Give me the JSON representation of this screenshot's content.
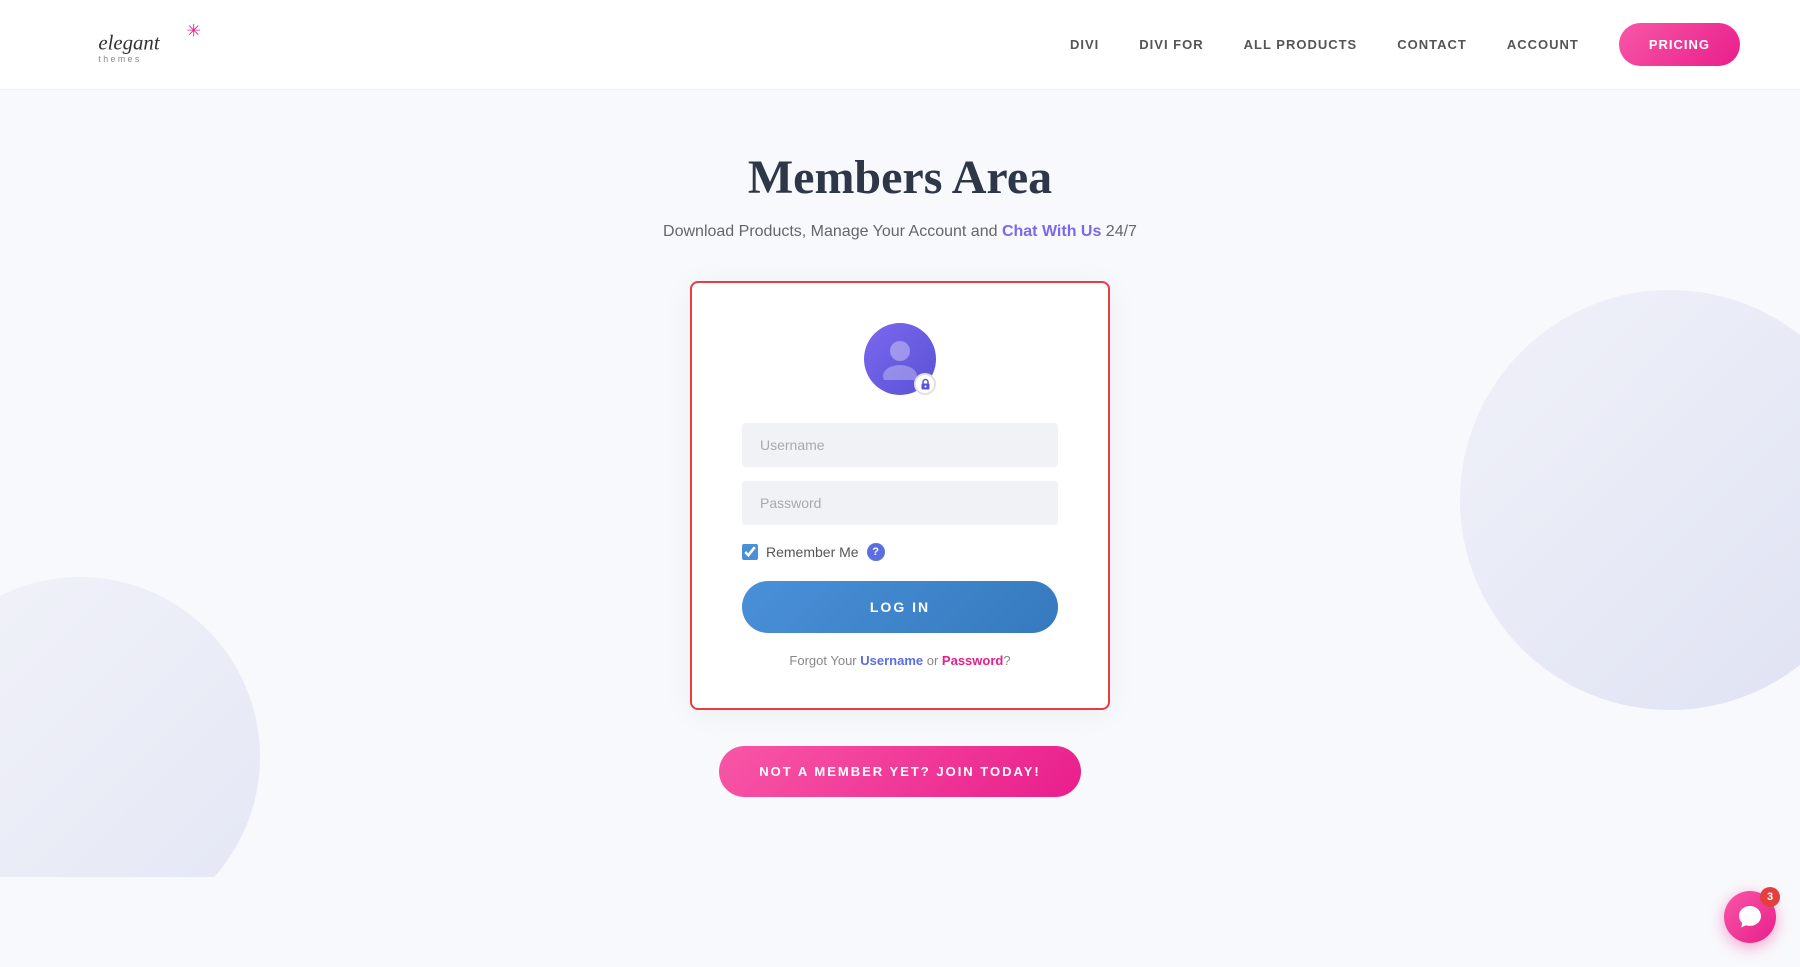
{
  "header": {
    "logo_alt": "Elegant Themes",
    "nav_items": [
      {
        "label": "DIVI",
        "key": "divi"
      },
      {
        "label": "DIVI FOR",
        "key": "divi-for"
      },
      {
        "label": "ALL PRODUCTS",
        "key": "all-products"
      },
      {
        "label": "CONTACT",
        "key": "contact"
      },
      {
        "label": "ACCOUNT",
        "key": "account"
      }
    ],
    "pricing_label": "PRICING"
  },
  "page": {
    "title": "Members Area",
    "subtitle_before": "Download Products, Manage Your Account and ",
    "subtitle_chat": "Chat With Us",
    "subtitle_after": " 24/7"
  },
  "login_card": {
    "username_placeholder": "Username",
    "password_placeholder": "Password",
    "remember_label": "Remember Me",
    "help_icon_label": "?",
    "login_button": "LOG IN",
    "forgot_prefix": "Forgot Your ",
    "username_link": "Username",
    "forgot_or": " or ",
    "password_link": "Password",
    "forgot_suffix": "?"
  },
  "join_button": "NOT A MEMBER YET? JOIN TODAY!",
  "chat_widget": {
    "badge_count": "3"
  },
  "colors": {
    "pink": "#e91e8c",
    "blue": "#4a90d9",
    "purple": "#7b68ee",
    "red_border": "#e53e3e"
  }
}
